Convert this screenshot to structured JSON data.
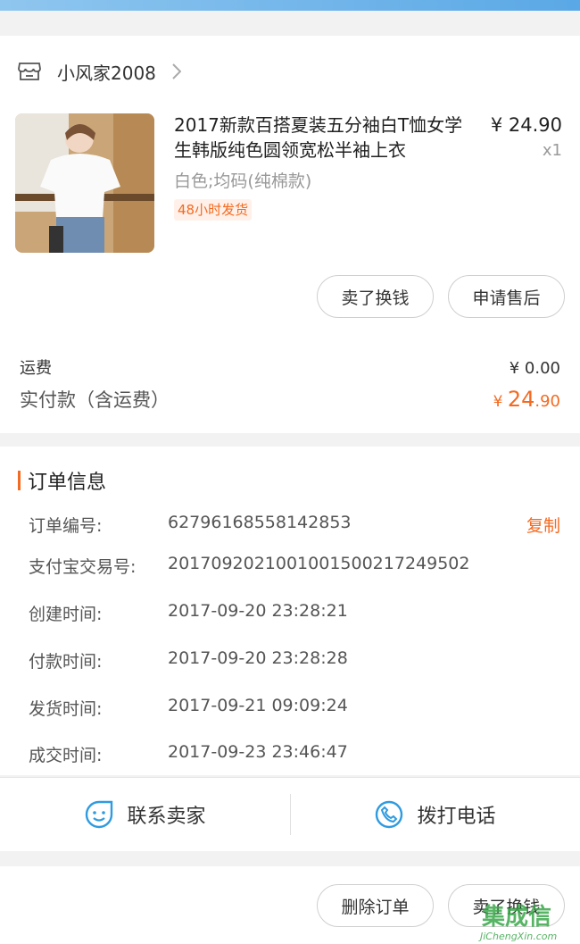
{
  "shop": {
    "name": "小风家2008"
  },
  "item": {
    "title": "2017新款百搭夏装五分袖白T恤女学生韩版纯色圆领宽松半袖上衣",
    "price": "¥ 24.90",
    "quantity": "x1",
    "sku": "白色;均码(纯棉款)",
    "tag": "48小时发货"
  },
  "actions": {
    "sell": "卖了换钱",
    "after_sale": "申请售后"
  },
  "fees": {
    "shipping_label": "运费",
    "shipping_value": "¥ 0.00",
    "paid_label": "实付款（含运费）",
    "paid_currency": "¥ ",
    "paid_int": "24",
    "paid_dec": ".90"
  },
  "order_info": {
    "title": "订单信息",
    "copy_label": "复制",
    "rows": [
      {
        "label": "订单编号:",
        "value": "62796168558142853"
      },
      {
        "label": "支付宝交易号:",
        "value": "2017092021001001500217249502"
      },
      {
        "label": "创建时间:",
        "value": "2017-09-20 23:28:21"
      },
      {
        "label": "付款时间:",
        "value": "2017-09-20 23:28:28"
      },
      {
        "label": "发货时间:",
        "value": "2017-09-21 09:09:24"
      },
      {
        "label": "成交时间:",
        "value": "2017-09-23 23:46:47"
      }
    ]
  },
  "contact": {
    "seller": "联系卖家",
    "call": "拨打电话"
  },
  "bottom": {
    "delete": "删除订单",
    "sell": "卖了换钱"
  },
  "watermark": {
    "logo": "集成信",
    "url": "JiChengXin.com"
  },
  "colors": {
    "accent": "#f46a21",
    "blue": "#2f9be0",
    "topbar": "#6cb3ea"
  }
}
